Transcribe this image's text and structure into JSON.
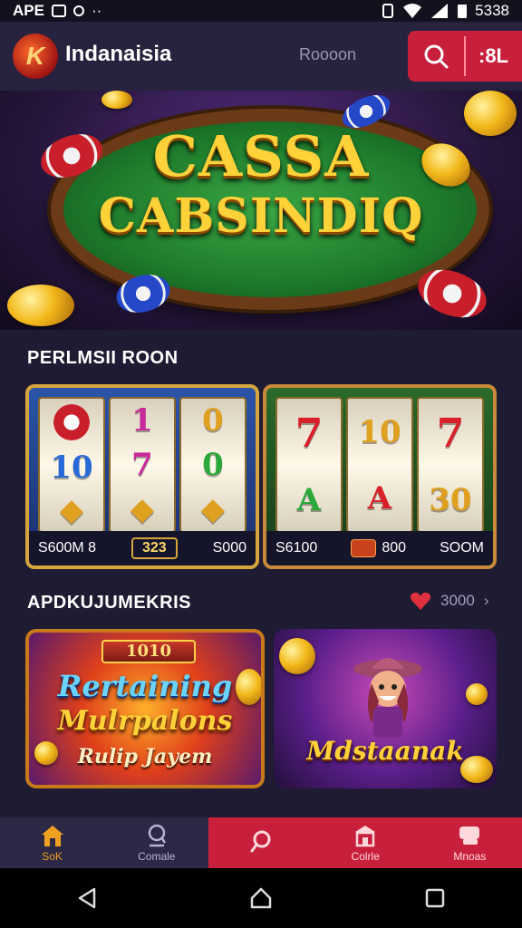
{
  "status_bar": {
    "left_text": "APE",
    "time": "5338"
  },
  "header": {
    "app_name": "Indanaisia",
    "link_label": "Roooon",
    "action_label": ":8L"
  },
  "hero": {
    "title_line1": "CASSA",
    "title_line2": "CABSINDIQ"
  },
  "promotions": {
    "title": "PERLMSII ROON",
    "cards": [
      {
        "reels": [
          [
            "",
            "1",
            "0"
          ],
          [
            "10",
            "7",
            "0"
          ]
        ],
        "footer_left": "S600M 8",
        "footer_pill": "323",
        "footer_right": "S000"
      },
      {
        "reels": [
          [
            "7",
            "10",
            "7"
          ],
          [
            "A",
            "A",
            "30"
          ]
        ],
        "footer_left": "S6100",
        "footer_mid": "800",
        "footer_right": "SOOM"
      }
    ]
  },
  "recommendations": {
    "title": "APDKUJUMEKRIS",
    "more_label": "3000",
    "games": [
      {
        "badge": "1010",
        "line1": "Rertaining",
        "line2": "Mulrpalons",
        "line3": "Rulip Jayem"
      },
      {
        "title": "Mdstaanak"
      }
    ]
  },
  "bottom_nav": {
    "items": [
      {
        "label": "SoK",
        "icon": "home-icon"
      },
      {
        "label": "Comale",
        "icon": "gamepad-icon"
      },
      {
        "label": "",
        "icon": "search-icon"
      },
      {
        "label": "Colrle",
        "icon": "store-icon"
      },
      {
        "label": "Mnoas",
        "icon": "chat-icon"
      }
    ]
  },
  "colors": {
    "accent_red": "#c8203c",
    "gold": "#ffd23a",
    "background": "#1f1b33",
    "active_nav": "#f0a020"
  }
}
